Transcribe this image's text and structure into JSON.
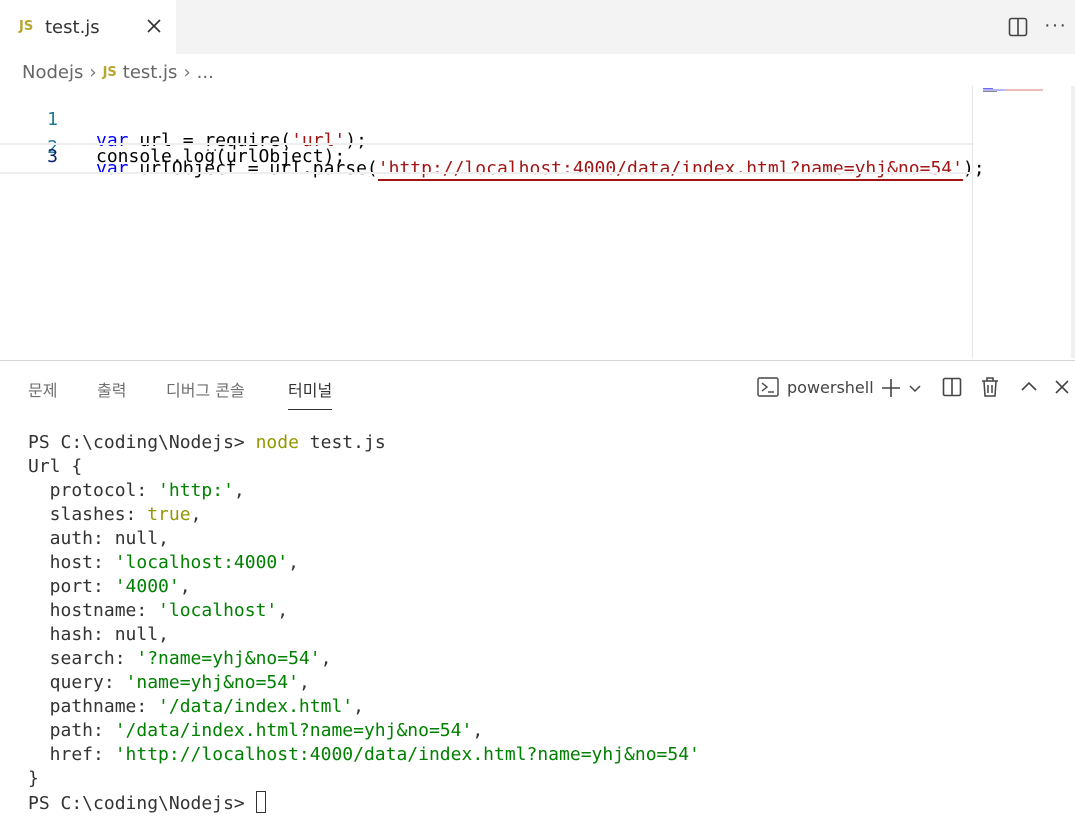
{
  "tab": {
    "icon": "JS",
    "filename": "test.js"
  },
  "breadcrumb": {
    "folder": "Nodejs",
    "icon": "JS",
    "file": "test.js",
    "more": "..."
  },
  "editor": {
    "lines": [
      {
        "num": "1",
        "parts": [
          "var",
          " url = ",
          "require",
          "(",
          "'url'",
          ");"
        ]
      },
      {
        "num": "2",
        "parts": [
          "var",
          " urlObject = url.parse(",
          "'http://localhost:4000/data/index.html?name=yhj&no=54'",
          ");"
        ]
      },
      {
        "num": "3",
        "parts": [
          "console.log(urlObject);"
        ]
      }
    ]
  },
  "panel": {
    "tabs": [
      "문제",
      "출력",
      "디버그 콘솔",
      "터미널"
    ],
    "shell": "powershell"
  },
  "terminal": {
    "prompt": "PS C:\\coding\\Nodejs>",
    "command": "node",
    "arg": "test.js",
    "open": "Url {",
    "fields": [
      {
        "key": "protocol",
        "value": "'http:'",
        "type": "str"
      },
      {
        "key": "slashes",
        "value": "true",
        "type": "bool"
      },
      {
        "key": "auth",
        "value": "null",
        "type": "plain"
      },
      {
        "key": "host",
        "value": "'localhost:4000'",
        "type": "str"
      },
      {
        "key": "port",
        "value": "'4000'",
        "type": "str"
      },
      {
        "key": "hostname",
        "value": "'localhost'",
        "type": "str"
      },
      {
        "key": "hash",
        "value": "null",
        "type": "plain"
      },
      {
        "key": "search",
        "value": "'?name=yhj&no=54'",
        "type": "str"
      },
      {
        "key": "query",
        "value": "'name=yhj&no=54'",
        "type": "str"
      },
      {
        "key": "pathname",
        "value": "'/data/index.html'",
        "type": "str"
      },
      {
        "key": "path",
        "value": "'/data/index.html?name=yhj&no=54'",
        "type": "str"
      },
      {
        "key": "href",
        "value": "'http://localhost:4000/data/index.html?name=yhj&no=54'",
        "type": "str"
      }
    ],
    "close": "}",
    "final_prompt": "PS C:\\coding\\Nodejs>"
  }
}
